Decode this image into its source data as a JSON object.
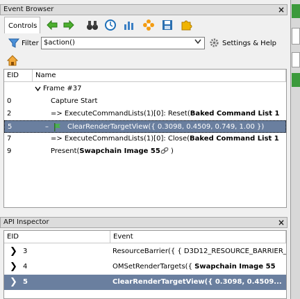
{
  "event_browser": {
    "title": "Event Browser",
    "tab_label": "Controls",
    "filter_label": "Filter",
    "filter_value": "$action()",
    "settings_label": "Settings & Help",
    "columns": {
      "eid": "EID",
      "name": "Name"
    },
    "rows": [
      {
        "eid": "",
        "name": "Frame #37"
      },
      {
        "eid": "0",
        "name": "Capture Start"
      },
      {
        "eid": "2",
        "name": "=> ExecuteCommandLists(1)[0]: Reset(",
        "bold": "Baked Command List 1"
      },
      {
        "eid": "5",
        "name": "ClearRenderTargetView({ 0.3098, 0.4509, 0.749, 1.00 })"
      },
      {
        "eid": "7",
        "name": "=> ExecuteCommandLists(1)[0]: Close(",
        "bold": "Baked Command List 1"
      },
      {
        "eid": "9",
        "name": "Present(",
        "bold": "Swapchain Image 55",
        "tail": " )"
      }
    ]
  },
  "api_inspector": {
    "title": "API Inspector",
    "columns": {
      "eid": "EID",
      "event": "Event"
    },
    "rows": [
      {
        "eid": "3",
        "event": "ResourceBarrier({ { D3D12_RESOURCE_BARRIER_"
      },
      {
        "eid": "4",
        "event": "OMSetRenderTargets({ ",
        "bold": "Swapchain Image 55"
      },
      {
        "eid": "5",
        "event": "ClearRenderTargetView({ 0.3098, 0.4509..."
      }
    ]
  },
  "colors": {
    "selection": "#6a7f9f",
    "accent_green": "#3c9a3c"
  }
}
